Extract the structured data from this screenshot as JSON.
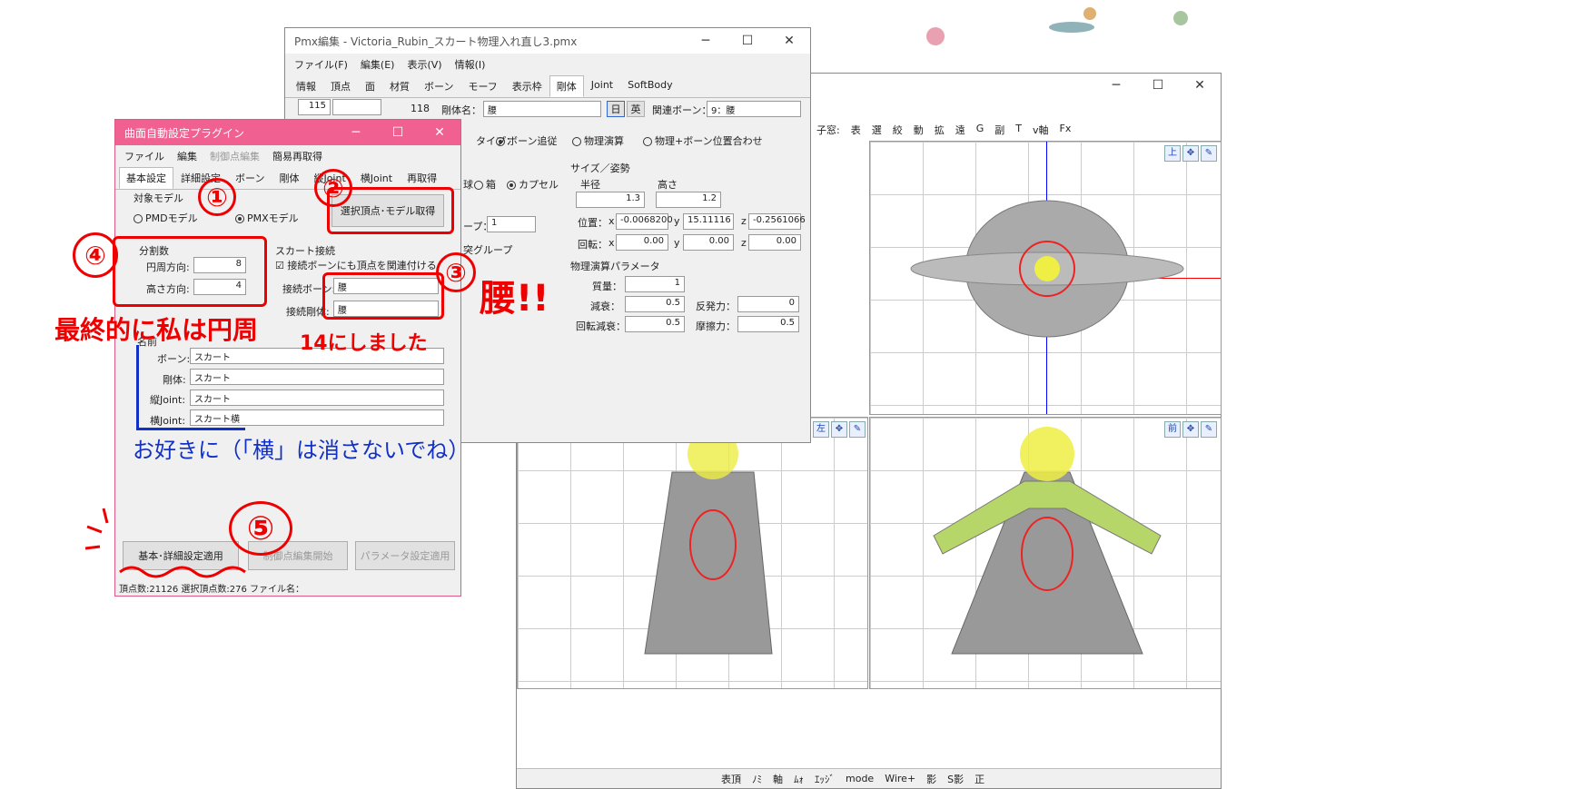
{
  "pmx": {
    "title": "Pmx編集 - Victoria_Rubin_スカート物理入れ直し3.pmx",
    "menu": [
      "ファイル(F)",
      "編集(E)",
      "表示(V)",
      "情報(I)"
    ],
    "tabs": [
      "情報",
      "頂点",
      "面",
      "材質",
      "ボーン",
      "モーフ",
      "表示枠",
      "剛体",
      "Joint",
      "SoftBody"
    ],
    "idx": "115",
    "count": "118",
    "body_name_label": "剛体名：",
    "body_name": "腰",
    "lang_jp": "日",
    "lang_en": "英",
    "rel_bone_label": "関連ボーン：",
    "rel_bone": "9：腰",
    "type_label": "タイプ：",
    "type_bone": "ボーン追従",
    "type_phys": "物理演算",
    "type_mix": "物理+ボーン位置合わせ",
    "shape_box": "箱",
    "shape_capsule": "カプセル",
    "shape_sphere": "球",
    "size_title": "サイズ／姿勢",
    "radius_label": "半径",
    "height_label": "高さ",
    "radius": "1.3",
    "height": "1.2",
    "pos_label": "位置：",
    "pos_x": "-0.0068200",
    "pos_y": "15.11116",
    "pos_z": "-0.2561066",
    "rot_label": "回転：",
    "rot_x": "0.00",
    "rot_y": "0.00",
    "rot_z": "0.00",
    "group_label": "ープ：",
    "group": "1",
    "collide_label": "突グループ",
    "phys_title": "物理演算パラメータ",
    "mass_label": "質量：",
    "mass": "1",
    "mdamp_label": "減衰：",
    "mdamp": "0.5",
    "repulse_label": "反発力：",
    "repulse": "0",
    "rdamp_label": "回転減衰：",
    "rdamp": "0.5",
    "friction_label": "摩擦力：",
    "friction": "0.5",
    "x": "x",
    "y": "y",
    "z": "z"
  },
  "plugin": {
    "title": "曲面自動設定プラグイン",
    "menu": [
      "ファイル",
      "編集",
      "制御点編集",
      "簡易再取得"
    ],
    "tabs": [
      "基本設定",
      "詳細設定",
      "ボーン",
      "剛体",
      "縦Joint",
      "横Joint",
      "再取得"
    ],
    "target_title": "対象モデル",
    "pmd": "PMDモデル",
    "pmx": "PMXモデル",
    "get_btn": "選択頂点･モデル取得",
    "div_title": "分割数",
    "circ_label": "円周方向:",
    "circ_val": "8",
    "height_label": "高さ方向:",
    "height_val": "4",
    "skirt_title": "スカート接続",
    "check_label": "接続ボーンにも頂点を関連付ける",
    "conn_bone_label": "接続ボーン:",
    "conn_bone": "腰",
    "conn_body_label": "接続剛体:",
    "conn_body": "腰",
    "name_title": "名前",
    "bone_label": "ボーン:",
    "bone": "スカート",
    "body_label": "剛体:",
    "body": "スカート",
    "vjoint_label": "縦Joint:",
    "vjoint": "スカート",
    "hjoint_label": "横Joint:",
    "hjoint": "スカート横",
    "apply_btn": "基本･詳細設定適用",
    "edit_btn": "制御点編集開始",
    "param_btn": "パラメータ設定適用",
    "status": "頂点数:21126 選択頂点数:276 ファイル名："
  },
  "ann": {
    "n1": "①",
    "n2": "②",
    "n3": "③",
    "n4": "④",
    "n5": "⑤",
    "waist": "腰!!",
    "final": "最終的に私は円周",
    "final2": "14にしました",
    "blue": "お好きに（「横」は消さないでね）"
  },
  "view": {
    "sub": "子窓:",
    "items": [
      "表",
      "選",
      "絞",
      "動",
      "拡",
      "遠",
      "G",
      "副",
      "T"
    ],
    "vaxis": "v軸",
    "fx": "Fx",
    "top": "上",
    "left": "左",
    "front": "前",
    "bottom": [
      "表頂",
      "ﾉﾐ",
      "軸",
      "ﾑｫ",
      "ｴｯｼﾞ",
      "mode",
      "Wire+",
      "影",
      "S影",
      "正"
    ]
  },
  "colors": {
    "red": "#e00",
    "blue": "#1030c8",
    "title_pink": "#f06090"
  }
}
